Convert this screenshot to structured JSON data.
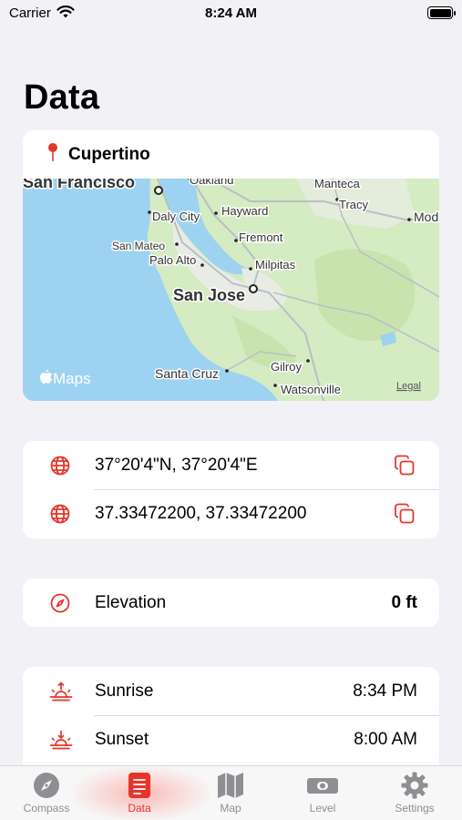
{
  "status_bar": {
    "carrier": "Carrier",
    "time": "8:24 AM"
  },
  "page": {
    "title": "Data"
  },
  "location": {
    "name": "Cupertino",
    "map_labels": {
      "san_francisco": "San Francisco",
      "oakland": "Oakland",
      "manteca": "Manteca",
      "tracy": "Tracy",
      "modesto": "Mod",
      "daly_city": "Daly City",
      "hayward": "Hayward",
      "fremont": "Fremont",
      "san_mateo": "San Mateo",
      "palo_alto": "Palo Alto",
      "milpitas": "Milpitas",
      "san_jose": "San Jose",
      "gilroy": "Gilroy",
      "santa_cruz": "Santa Cruz",
      "watsonville": "Watsonville",
      "maps_brand": "Maps",
      "legal": "Legal"
    }
  },
  "coordinates": {
    "dms": "37°20'4\"N, 37°20'4\"E",
    "decimal": "37.33472200, 37.33472200"
  },
  "elevation": {
    "label": "Elevation",
    "value": "0 ft"
  },
  "sun": {
    "sunrise_label": "Sunrise",
    "sunrise_time": "8:34 PM",
    "sunset_label": "Sunset",
    "sunset_time": "8:00 AM"
  },
  "tabs": [
    {
      "label": "Compass",
      "icon": "compass-icon",
      "active": false
    },
    {
      "label": "Data",
      "icon": "data-icon",
      "active": true
    },
    {
      "label": "Map",
      "icon": "map-icon",
      "active": false
    },
    {
      "label": "Level",
      "icon": "level-icon",
      "active": false
    },
    {
      "label": "Settings",
      "icon": "gear-icon",
      "active": false
    }
  ],
  "colors": {
    "accent": "#e5352b",
    "background": "#f2f2f6",
    "water": "#9dd3f0",
    "land": "#d5ebc2"
  }
}
